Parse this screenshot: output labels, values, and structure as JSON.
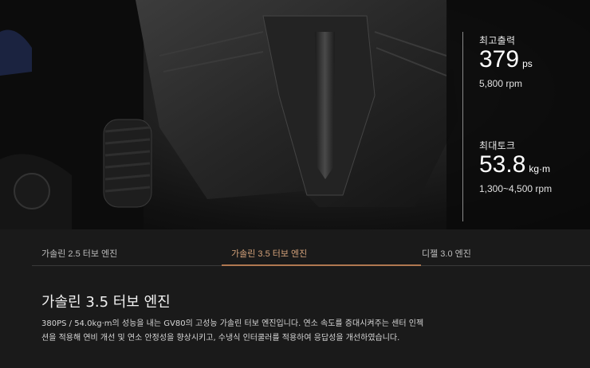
{
  "specs": {
    "power": {
      "label": "최고출력",
      "value": "379",
      "unit": "ps",
      "rpm": "5,800 rpm"
    },
    "torque": {
      "label": "최대토크",
      "value": "53.8",
      "unit": "kg·m",
      "rpm": "1,300~4,500 rpm"
    }
  },
  "tabs": [
    {
      "label": "가솔린 2.5 터보 엔진",
      "active": false
    },
    {
      "label": "가솔린 3.5 터보 엔진",
      "active": true
    },
    {
      "label": "디젤 3.0 엔진",
      "active": false
    }
  ],
  "section": {
    "title": "가솔린 3.5 터보 엔진",
    "description": "380PS / 54.0kg·m의 성능을 내는 GV80의 고성능 가솔린 터보 엔진입니다. 연소 속도를 증대시켜주는 센터 인젝션을 적용해 연비 개선 및 연소 안정성을 향상시키고, 수냉식 인터쿨러를 적용하여 응답성을 개선하였습니다."
  },
  "colors": {
    "accent": "#b07850",
    "background": "#1a1a1a"
  }
}
